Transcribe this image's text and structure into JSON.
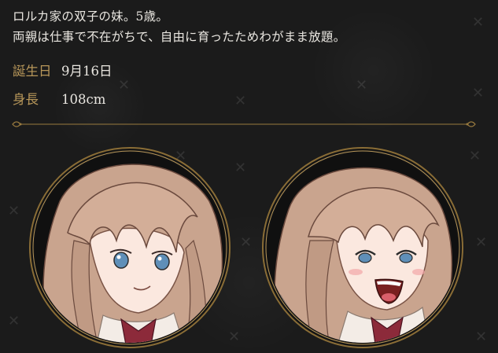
{
  "profile": {
    "description_line1": "ロルカ家の双子の妹。5歳。",
    "description_line2": "両親は仕事で不在がちで、自由に育ったためわがまま放題。",
    "birthday_label": "誕生日",
    "birthday_value": "9月16日",
    "height_label": "身長",
    "height_value": "108cm"
  },
  "colors": {
    "background": "#1b1b1b",
    "text": "#e9e6e0",
    "label_gold": "#b8975a",
    "frame_gold": "#9a7b3f",
    "hair": "#c9a48e",
    "skin": "#fbe8df",
    "eyes": "#5f8fb8",
    "ribbon": "#8c2a3a"
  },
  "portraits": [
    {
      "name": "portrait-calm",
      "expression": "smile"
    },
    {
      "name": "portrait-laughing",
      "expression": "laugh"
    }
  ]
}
